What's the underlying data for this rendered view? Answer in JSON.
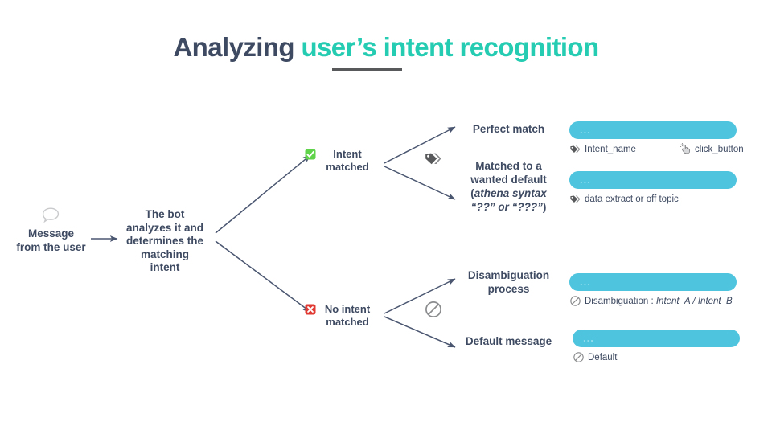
{
  "title": {
    "part_dark": "Analyzing",
    "part_teal": "user’s intent recognition",
    "colors": {
      "dark": "#3e4a61",
      "teal": "#25ccb2",
      "underline": "#58595b"
    }
  },
  "theme": {
    "accent_cyan": "#4ec4de",
    "text_navy": "#3e4a61",
    "success_green": "#5fd34a",
    "error_red": "#e03a33",
    "icon_gray": "#6d6e71"
  },
  "flow": {
    "start": {
      "label": "Message\nfrom the user",
      "line1": "Message",
      "line2": "from the user",
      "icon": "speech-bubble-icon"
    },
    "process": {
      "line1": "The bot",
      "line2": "analyzes it and",
      "line3": "determines the",
      "line4": "matching",
      "line5": "intent"
    },
    "branches": [
      {
        "id": "intent-matched",
        "line1": "Intent",
        "line2": "matched",
        "badge": "check-mark-button-icon",
        "mid_icon": "tag-icon"
      },
      {
        "id": "no-intent-matched",
        "line1": "No intent",
        "line2": "matched",
        "badge": "cross-mark-button-icon",
        "mid_icon": "prohibited-icon"
      }
    ]
  },
  "outcomes": {
    "perfect_match": {
      "line1": "Perfect match"
    },
    "wanted_default": {
      "line1": "Matched to a",
      "line2": "wanted default",
      "line3_prefix": "(",
      "line3_italic": "athena syntax",
      "line4_italic": "“??” or “???”",
      "line4_suffix": ")"
    },
    "disambiguation": {
      "line1": "Disambiguation",
      "line2": "process"
    },
    "default_message": {
      "line1": "Default message"
    }
  },
  "cards": {
    "perfect_match": {
      "bar_placeholder": "...",
      "items": [
        {
          "icon": "tag-icon",
          "text": "Intent_name"
        },
        {
          "icon": "click-hand-icon",
          "text": "click_button"
        }
      ]
    },
    "wanted_default": {
      "bar_placeholder": "...",
      "items": [
        {
          "icon": "tag-icon",
          "text": "data extract or off topic"
        }
      ]
    },
    "disambiguation": {
      "bar_placeholder": "...",
      "items": [
        {
          "icon": "prohibited-icon",
          "text_prefix": "Disambiguation : ",
          "text_italic": "Intent_A / Intent_B"
        }
      ]
    },
    "default_message": {
      "bar_placeholder": "...",
      "items": [
        {
          "icon": "prohibited-icon",
          "text": "Default"
        }
      ]
    }
  }
}
